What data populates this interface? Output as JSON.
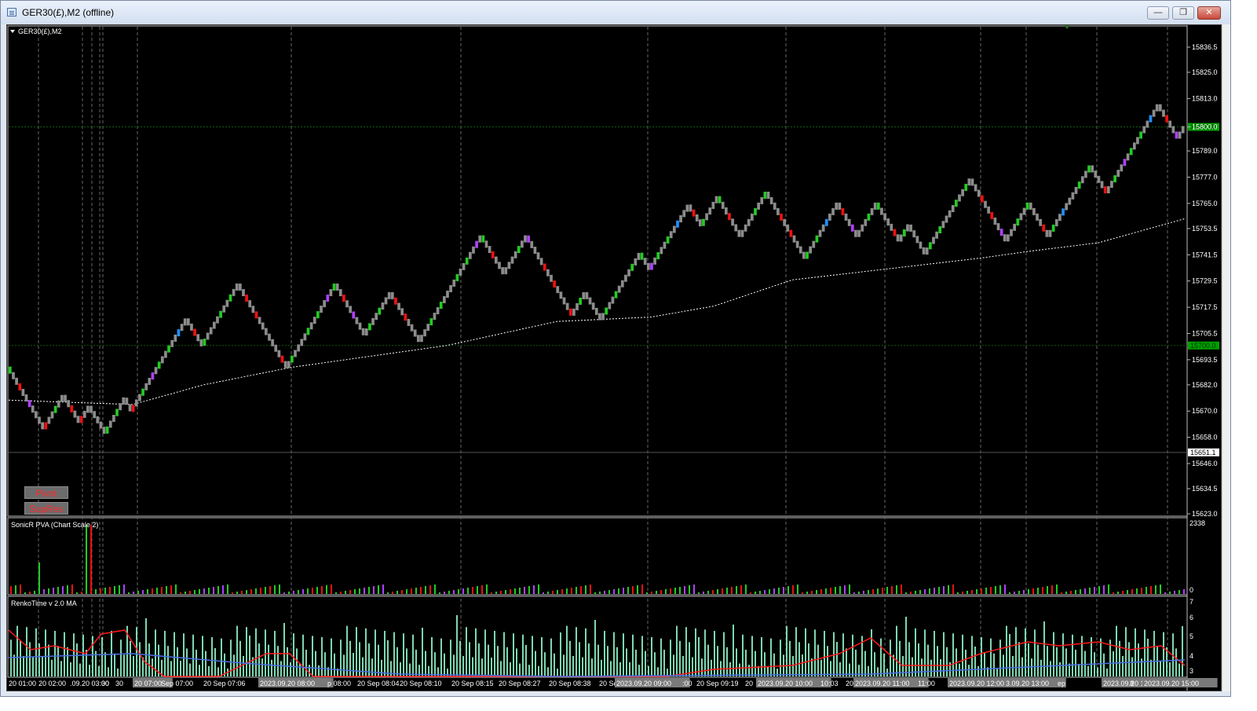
{
  "window": {
    "title": "GER30(£),M2 (offline)",
    "buttons": [
      "minimize",
      "maximize",
      "close"
    ]
  },
  "main_chart": {
    "label": "GER30(£),M2",
    "price_ticks": [
      "15836.5",
      "15825.0",
      "15813.0",
      "15800.0",
      "15789.0",
      "15777.0",
      "15765.0",
      "15753.5",
      "15741.5",
      "15729.5",
      "15717.5",
      "15705.5",
      "15693.5",
      "15682.0",
      "15670.0",
      "15658.0",
      "15646.0",
      "15634.5",
      "15623.0"
    ],
    "price_tick_values": [
      15836.5,
      15825.0,
      15813.0,
      15800.0,
      15789.0,
      15777.0,
      15765.0,
      15753.5,
      15741.5,
      15729.5,
      15717.5,
      15705.5,
      15693.5,
      15682.0,
      15670.0,
      15658.0,
      15646.0,
      15634.5,
      15623.0
    ],
    "level_lines": [
      {
        "value": "15800.0",
        "price": 15800.0,
        "color": "#00a000"
      },
      {
        "value": "15700.0",
        "price": 15700.0,
        "color": "#00a000"
      }
    ],
    "current_price": {
      "value": "15651.1",
      "price": 15651.1
    },
    "buttons": [
      {
        "name": "pivot",
        "label": "Pivot"
      },
      {
        "name": "supres",
        "label": "SupRes"
      }
    ],
    "colors": {
      "gray": "#8c8c8c",
      "green": "#22cc22",
      "red": "#ee1111",
      "purple": "#b040ff",
      "blue": "#1e90ff",
      "ma": "#ffffff"
    }
  },
  "volume_panel": {
    "label": "SonicR PVA  (Chart Scale 2)",
    "scale_max": "2338",
    "scale_min": "0"
  },
  "time_panel": {
    "label": "RenkoTime v 2.0 MA",
    "scale_ticks": [
      "7",
      "6",
      "5",
      "4",
      "3"
    ],
    "bar_color": "#7dd8b0",
    "red_line_color": "#ff1a1a",
    "blue_line_color": "#4a70e0"
  },
  "time_axis": {
    "labels": [
      {
        "text": "20 01:00",
        "kind": "plain"
      },
      {
        "text": "20 02:00",
        "kind": "plain"
      },
      {
        "text": ".09.20 03:00",
        "kind": "plain"
      },
      {
        "text": "30",
        "kind": "plain"
      },
      {
        "text": "30",
        "kind": "plain"
      },
      {
        "text": "20 07:00",
        "kind": "hl"
      },
      {
        "text": "Sep 07:00",
        "kind": "plain"
      },
      {
        "text": "20 Sep 07:06",
        "kind": "plain"
      },
      {
        "text": "2023.09.20 08:00",
        "kind": "hl"
      },
      {
        "text": "p 08:00",
        "kind": "plain"
      },
      {
        "text": "20 Sep 08:04",
        "kind": "plain"
      },
      {
        "text": "20 Sep 08:10",
        "kind": "plain"
      },
      {
        "text": "20 Sep 08:15",
        "kind": "plain"
      },
      {
        "text": "20 Sep 08:27",
        "kind": "plain"
      },
      {
        "text": "20 Sep 08:38",
        "kind": "plain"
      },
      {
        "text": "20 Se",
        "kind": "plain"
      },
      {
        "text": "2023.09.20 09:00",
        "kind": "hl"
      },
      {
        "text": ":00",
        "kind": "plain"
      },
      {
        "text": "20 Sep 09:19",
        "kind": "plain"
      },
      {
        "text": "20",
        "kind": "plain"
      },
      {
        "text": "2023.09.20 10:00",
        "kind": "hl"
      },
      {
        "text": "10:03",
        "kind": "plain"
      },
      {
        "text": "20",
        "kind": "plain"
      },
      {
        "text": "2023.09.20 11:00",
        "kind": "hl"
      },
      {
        "text": "11:00",
        "kind": "plain"
      },
      {
        "text": "2023.09.20 12:00",
        "kind": "hl"
      },
      {
        "text": "3.09.20 13:00",
        "kind": "hl"
      },
      {
        "text": "ep",
        "kind": "plain"
      },
      {
        "text": "2023.09.20 14:00",
        "kind": "hl"
      },
      {
        "text": "8",
        "kind": "plain"
      },
      {
        "text": "2023.09.20 15:00",
        "kind": "hl"
      }
    ]
  }
}
